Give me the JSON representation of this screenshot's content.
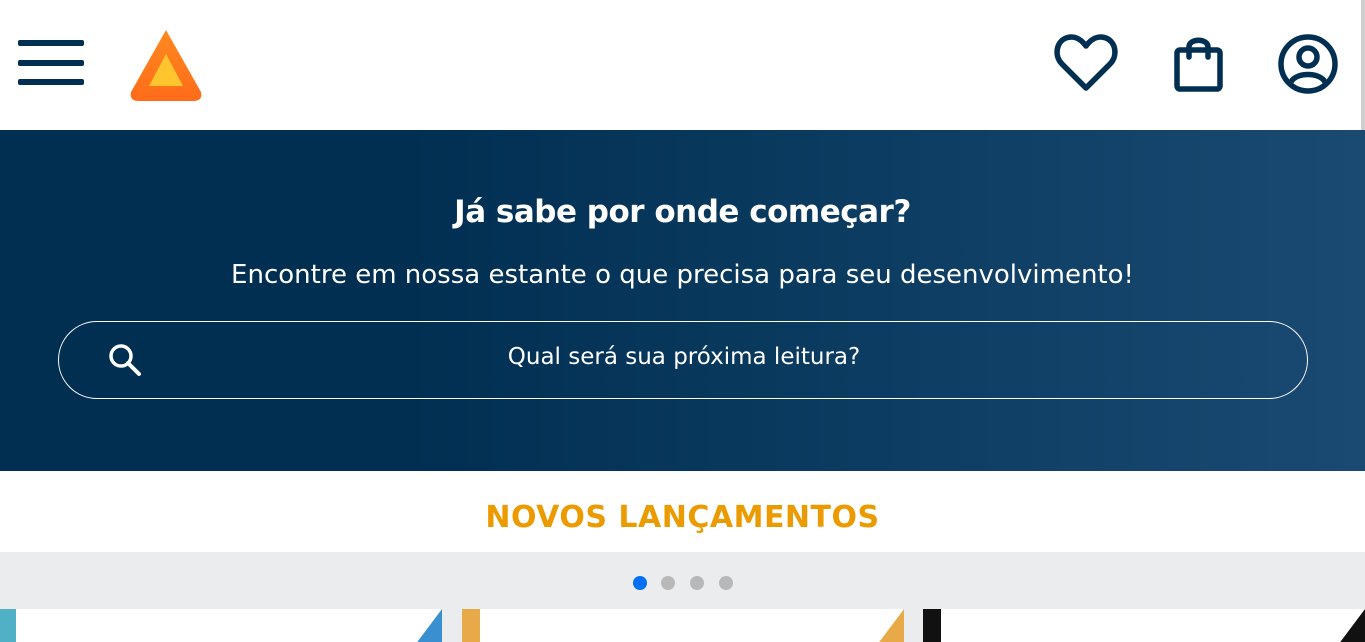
{
  "header": {
    "menu_icon": "hamburger-menu-icon",
    "logo_icon": "orange-triangle-logo",
    "favorites_icon": "heart-icon",
    "bag_icon": "shopping-bag-icon",
    "account_icon": "user-circle-icon"
  },
  "hero": {
    "title": "Já sabe por onde começar?",
    "subtitle": "Encontre em nossa estante o que precisa para seu desenvolvimento!",
    "search": {
      "placeholder": "Qual será sua próxima leitura?",
      "icon": "search-icon"
    }
  },
  "releases": {
    "title": "NOVOS LANÇAMENTOS",
    "carousel_page": 1,
    "carousel_pages": 4
  },
  "colors": {
    "brand_dark_blue": "#002F52",
    "accent_orange": "#EB9B00",
    "logo_orange": "#FF7A1A",
    "logo_yellow": "#FFC52E",
    "carousel_bg": "#EBECEE",
    "dot_active": "#0070F3",
    "dot_inactive": "#B8B8B8"
  }
}
